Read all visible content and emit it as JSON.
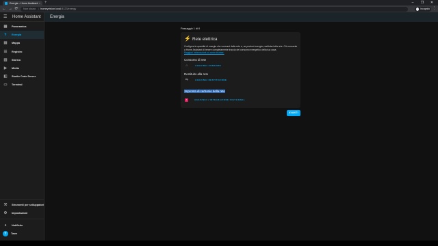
{
  "browser": {
    "tab_title": "Energia – Home Assistant",
    "tab_close": "×",
    "new_tab": "+",
    "window_controls": [
      "–",
      "❐",
      "✕"
    ],
    "nav": [
      "←",
      "→",
      "⟳"
    ],
    "address": {
      "warning": "Non sicuro",
      "host": "homeyvision.local",
      "path": ":8123/energy"
    },
    "profile_name": "Incognito",
    "menu": "⋮"
  },
  "sidebar": {
    "title": "Home Assistant",
    "items": [
      {
        "label": "Panoramica",
        "icon": "dashboard-icon",
        "glyph": "▦",
        "active": false
      },
      {
        "label": "Energia",
        "icon": "lightning-icon",
        "glyph": "ϟ",
        "active": true
      },
      {
        "label": "Mappa",
        "icon": "map-icon",
        "glyph": "▤",
        "active": false
      },
      {
        "label": "Registro",
        "icon": "list-icon",
        "glyph": "☰",
        "active": false
      },
      {
        "label": "Storico",
        "icon": "chart-icon",
        "glyph": "▥",
        "active": false
      },
      {
        "label": "Media",
        "icon": "play-icon",
        "glyph": "▶",
        "active": false
      },
      {
        "label": "Studio Code Server",
        "icon": "code-icon",
        "glyph": "◧",
        "active": false
      },
      {
        "label": "Terminal",
        "icon": "console-icon",
        "glyph": "▭",
        "active": false
      }
    ],
    "dev_tools": "Strumenti per sviluppatori",
    "settings": "Impostazioni",
    "notifications": "Notifiche",
    "user": "Twee",
    "user_initial": "T"
  },
  "header": {
    "title": "Energia"
  },
  "wizard": {
    "step": "Passaggio 1 di 6",
    "title": "Rete elettrica",
    "description": "Configura la quantità di energia che consumi dalla rete e, se produci energia, restituisci alla rete. Ciò consente a Home Assistant di tenere completamente traccia del consumo energetico della tua casa.",
    "link": "Maggiori informazioni su come iniziare.",
    "consumption_title": "Consumo di rete",
    "consumption_button": "AGGIUNGI CONSUMO",
    "return_title": "Restituito alla rete",
    "return_button": "AGGIUNGI RESTITUZIONE",
    "co2_title": "Impronta di carbonio della rete",
    "co2_button": "AGGIUNGI L'INTEGRAZIONE CO2 SIGNAL",
    "next": "AVANTI"
  }
}
